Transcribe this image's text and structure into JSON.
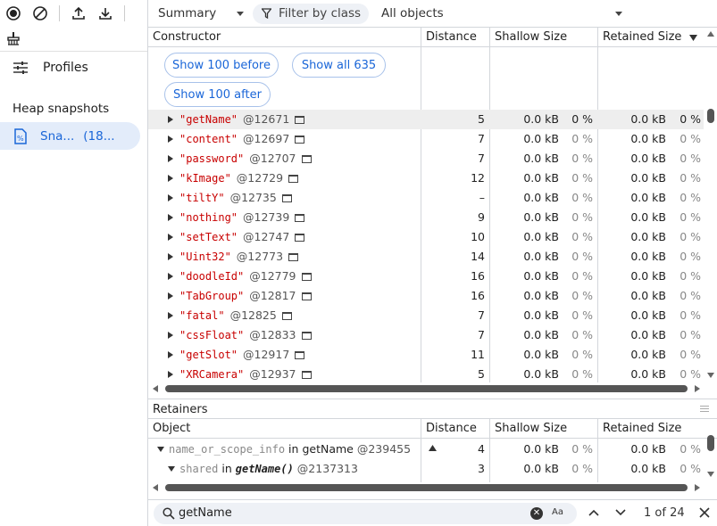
{
  "toolbar": {
    "icons": [
      "record-icon",
      "clear-icon",
      "upload-icon",
      "download-icon",
      "collect-garbage-icon"
    ]
  },
  "sidebar": {
    "profiles_label": "Profiles",
    "heap_snapshots_title": "Heap snapshots",
    "snapshot_item": {
      "name": "Sna...",
      "size": "(18..."
    }
  },
  "main_toolbar": {
    "view": "Summary",
    "filter_placeholder": "Filter by class",
    "objects": "All objects"
  },
  "grid": {
    "headers": {
      "constructor": "Constructor",
      "distance": "Distance",
      "shallow": "Shallow Size",
      "retained": "Retained Size"
    },
    "buttons": {
      "before": "Show 100 before",
      "all": "Show all 635",
      "after": "Show 100 after"
    },
    "rows": [
      {
        "name": "\"getName\"",
        "id": "@12671",
        "distance": "5",
        "shallow": "0.0 kB",
        "shallow_pct": "0 %",
        "retained": "0.0 kB",
        "retained_pct": "0 %",
        "selected": true
      },
      {
        "name": "\"content\"",
        "id": "@12697",
        "distance": "7",
        "shallow": "0.0 kB",
        "shallow_pct": "0 %",
        "retained": "0.0 kB",
        "retained_pct": "0 %"
      },
      {
        "name": "\"password\"",
        "id": "@12707",
        "distance": "7",
        "shallow": "0.0 kB",
        "shallow_pct": "0 %",
        "retained": "0.0 kB",
        "retained_pct": "0 %"
      },
      {
        "name": "\"kImage\"",
        "id": "@12729",
        "distance": "12",
        "shallow": "0.0 kB",
        "shallow_pct": "0 %",
        "retained": "0.0 kB",
        "retained_pct": "0 %"
      },
      {
        "name": "\"tiltY\"",
        "id": "@12735",
        "distance": "–",
        "shallow": "0.0 kB",
        "shallow_pct": "0 %",
        "retained": "0.0 kB",
        "retained_pct": "0 %"
      },
      {
        "name": "\"nothing\"",
        "id": "@12739",
        "distance": "9",
        "shallow": "0.0 kB",
        "shallow_pct": "0 %",
        "retained": "0.0 kB",
        "retained_pct": "0 %"
      },
      {
        "name": "\"setText\"",
        "id": "@12747",
        "distance": "10",
        "shallow": "0.0 kB",
        "shallow_pct": "0 %",
        "retained": "0.0 kB",
        "retained_pct": "0 %"
      },
      {
        "name": "\"Uint32\"",
        "id": "@12773",
        "distance": "14",
        "shallow": "0.0 kB",
        "shallow_pct": "0 %",
        "retained": "0.0 kB",
        "retained_pct": "0 %"
      },
      {
        "name": "\"doodleId\"",
        "id": "@12779",
        "distance": "16",
        "shallow": "0.0 kB",
        "shallow_pct": "0 %",
        "retained": "0.0 kB",
        "retained_pct": "0 %"
      },
      {
        "name": "\"TabGroup\"",
        "id": "@12817",
        "distance": "16",
        "shallow": "0.0 kB",
        "shallow_pct": "0 %",
        "retained": "0.0 kB",
        "retained_pct": "0 %"
      },
      {
        "name": "\"fatal\"",
        "id": "@12825",
        "distance": "7",
        "shallow": "0.0 kB",
        "shallow_pct": "0 %",
        "retained": "0.0 kB",
        "retained_pct": "0 %"
      },
      {
        "name": "\"cssFloat\"",
        "id": "@12833",
        "distance": "7",
        "shallow": "0.0 kB",
        "shallow_pct": "0 %",
        "retained": "0.0 kB",
        "retained_pct": "0 %"
      },
      {
        "name": "\"getSlot\"",
        "id": "@12917",
        "distance": "11",
        "shallow": "0.0 kB",
        "shallow_pct": "0 %",
        "retained": "0.0 kB",
        "retained_pct": "0 %"
      },
      {
        "name": "\"XRCamera\"",
        "id": "@12937",
        "distance": "5",
        "shallow": "0.0 kB",
        "shallow_pct": "0 %",
        "retained": "0.0 kB",
        "retained_pct": "0 %"
      }
    ]
  },
  "retainers": {
    "title": "Retainers",
    "headers": {
      "object": "Object",
      "distance": "Distance",
      "shallow": "Shallow Size",
      "retained": "Retained Size"
    },
    "rows": [
      {
        "prop": "name_or_scope_info",
        "in": "in",
        "obj": "getName",
        "id": "@239455",
        "distance": "4",
        "shallow": "0.0 kB",
        "shallow_pct": "0 %",
        "retained": "0.0 kB",
        "retained_pct": "0 %"
      },
      {
        "prop": "shared",
        "in": "in",
        "obj": "getName()",
        "id": "@2137313",
        "distance": "3",
        "shallow": "0.0 kB",
        "shallow_pct": "0 %",
        "retained": "0.0 kB",
        "retained_pct": "0 %"
      }
    ]
  },
  "search": {
    "value": "getName",
    "case_label": "Aa",
    "match_count": "1 of 24"
  }
}
